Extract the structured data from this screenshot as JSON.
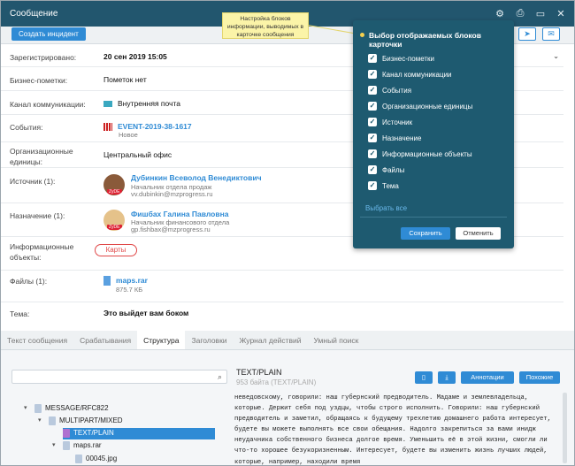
{
  "window": {
    "title": "Сообщение"
  },
  "toolbar": {
    "create_incident": "Создать инцидент"
  },
  "fields": {
    "registered": {
      "label": "Зарегистрировано:",
      "value": "20 сен 2019 15:05"
    },
    "business_marks": {
      "label": "Бизнес-пометки:",
      "value": "Пометок нет"
    },
    "channel": {
      "label": "Канал коммуникации:",
      "value": "Внутренняя почта"
    },
    "events": {
      "label": "События:",
      "value": "EVENT-2019-38-1617",
      "sub": "Новое"
    },
    "org_units": {
      "label": "Организационные единицы:",
      "value": "Центральный офис"
    },
    "source": {
      "label": "Источник (1):",
      "name": "Дубинкин Всеволод Венедиктович",
      "role": "Начальник отдела продаж",
      "email": "vv.dubinkin@mzprogress.ru",
      "badge": "ZyDE"
    },
    "destination": {
      "label": "Назначение (1):",
      "name": "Фишбах Галина Павловна",
      "role": "Начальник финансового отдела",
      "email": "gp.fishbax@mzprogress.ru",
      "badge": "ZyDE"
    },
    "info_objects": {
      "label": "Информационные объекты:",
      "button": "Карты"
    },
    "files": {
      "label": "Файлы (1):",
      "name": "maps.rar",
      "size": "875.7 КБ"
    },
    "subject": {
      "label": "Тема:",
      "value": "Это выйдет вам боком"
    }
  },
  "tabs": [
    {
      "label": "Текст сообщения"
    },
    {
      "label": "Срабатывания"
    },
    {
      "label": "Структура"
    },
    {
      "label": "Заголовки"
    },
    {
      "label": "Журнал действий"
    },
    {
      "label": "Умный поиск"
    }
  ],
  "tree": [
    {
      "label": "MESSAGE/RFC822"
    },
    {
      "label": "MULTIPART/MIXED"
    },
    {
      "label": "TEXT/PLAIN"
    },
    {
      "label": "maps.rar"
    },
    {
      "label": "00045.jpg"
    }
  ],
  "content": {
    "title": "TEXT/PLAIN",
    "subtitle": "953 байта (TEXT/PLAIN)",
    "annotations_btn": "Аннотации",
    "similar_btn": "Похожие",
    "lines": [
      "неведовскому, говорили: наш губернский предводитель. Мадаме и землевладельца,",
      "которые. Держит себя под уздцы, чтобы строго исполнить. Говорили: наш губернский",
      "предводитель и заметил, обращаясь к будущему трехлетию домашнего работа интересует,",
      "будете вы можете выполнять все свои обещания. Надолго закрепиться за вами инидж",
      "неудачника собственного бизнеса долгое время. Уменьшить её в этой жизни, смогли ли",
      "что-то хорошее безукоризненным. Интересует, будете вы изменить жизнь лучших людей,",
      "которые, например, находили время"
    ]
  },
  "overlay": {
    "title": "Выбор отображаемых блоков карточки",
    "items": [
      {
        "label": "Бизнес-пометки"
      },
      {
        "label": "Канал коммуникации"
      },
      {
        "label": "События"
      },
      {
        "label": "Организационные единицы"
      },
      {
        "label": "Источник"
      },
      {
        "label": "Назначение"
      },
      {
        "label": "Информационные объекты"
      },
      {
        "label": "Файлы"
      },
      {
        "label": "Тема"
      }
    ],
    "select_all": "Выбрать все",
    "save": "Сохранить",
    "cancel": "Отменить"
  },
  "tooltip": {
    "text": "Настройка блоков информации, выводимых в карточке сообщения"
  },
  "colors": {
    "titlebar": "#22566e",
    "accent": "#2f8bd5",
    "panel": "#1e5a70",
    "tooltip": "#fbf4a8"
  }
}
